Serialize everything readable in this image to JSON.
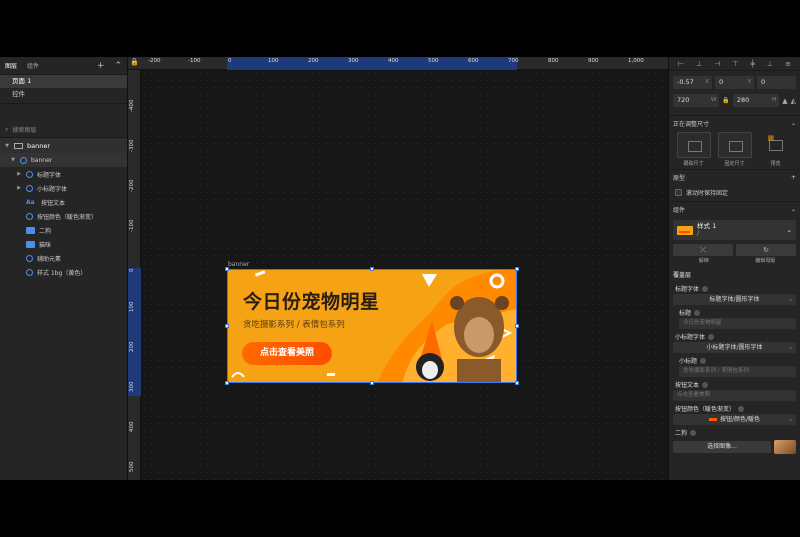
{
  "left_panel": {
    "tabs": [
      "图层",
      "组件"
    ],
    "pages": [
      "页面 1",
      "控件"
    ],
    "search_placeholder": "搜索图层",
    "frame_name": "banner",
    "layers": [
      {
        "name": "banner",
        "kind": "symbol",
        "depth": 0
      },
      {
        "name": "标题字体",
        "kind": "symbol",
        "depth": 1
      },
      {
        "name": "小标题字体",
        "kind": "symbol",
        "depth": 1
      },
      {
        "name": "按钮文本",
        "kind": "text",
        "depth": 1
      },
      {
        "name": "按钮颜色（暖色渐变）",
        "kind": "symbol",
        "depth": 1
      },
      {
        "name": "二狗",
        "kind": "image",
        "depth": 1
      },
      {
        "name": "猫咪",
        "kind": "image",
        "depth": 1
      },
      {
        "name": "辅助元素",
        "kind": "symbol",
        "depth": 1
      },
      {
        "name": "样式 1bg（黄色）",
        "kind": "symbol",
        "depth": 1
      }
    ]
  },
  "ruler": {
    "h_ticks": [
      "-200",
      "-100",
      "0",
      "100",
      "200",
      "300",
      "400",
      "500",
      "600",
      "700",
      "800",
      "900",
      "1,000"
    ],
    "v_ticks": [
      "-400",
      "-300",
      "-200",
      "-100",
      "0",
      "100",
      "200",
      "300",
      "400",
      "500"
    ]
  },
  "canvas": {
    "frame_label": "banner",
    "banner": {
      "title": "今日份宠物明星",
      "subtitle": "贪吃摄影系列 / 表情包系列",
      "button": "点击查看美照",
      "bg_color": "#f5a315",
      "button_color": "#ff5a00"
    }
  },
  "right_panel": {
    "x": "-0.57",
    "y": "0",
    "rotation": "0",
    "width": "720",
    "height": "280",
    "resize_section": "正在调整尺寸",
    "resize_options": [
      "跟踪尺寸",
      "固定尺寸",
      "预览"
    ],
    "prototype_section": "原型",
    "fix_on_scroll": "滚动时保持固定",
    "component_section": "组件",
    "component_name": "样式 1",
    "component_sub": "/",
    "detach_label": "解绑",
    "edit_master_label": "编辑母版",
    "overrides_title": "覆盖层",
    "overrides": {
      "title_font_label": "标题字体",
      "title_font_value": "标题字体/圆形字体",
      "title_label": "标题",
      "title_placeholder": "今日份宠物明星",
      "subtitle_font_label": "小标题字体",
      "subtitle_font_value": "小标题字体/圆形字体",
      "subtitle_label": "小标题",
      "subtitle_placeholder": "贪吃摄影系列 / 表情包系列",
      "button_text_label": "按钮文本",
      "button_text_placeholder": "点击查看美照",
      "button_color_label": "按钮颜色（暖色渐变）",
      "button_color_value": "按钮/颜色/暖色",
      "dog_label": "二狗",
      "choose_image": "选择图像..."
    }
  }
}
